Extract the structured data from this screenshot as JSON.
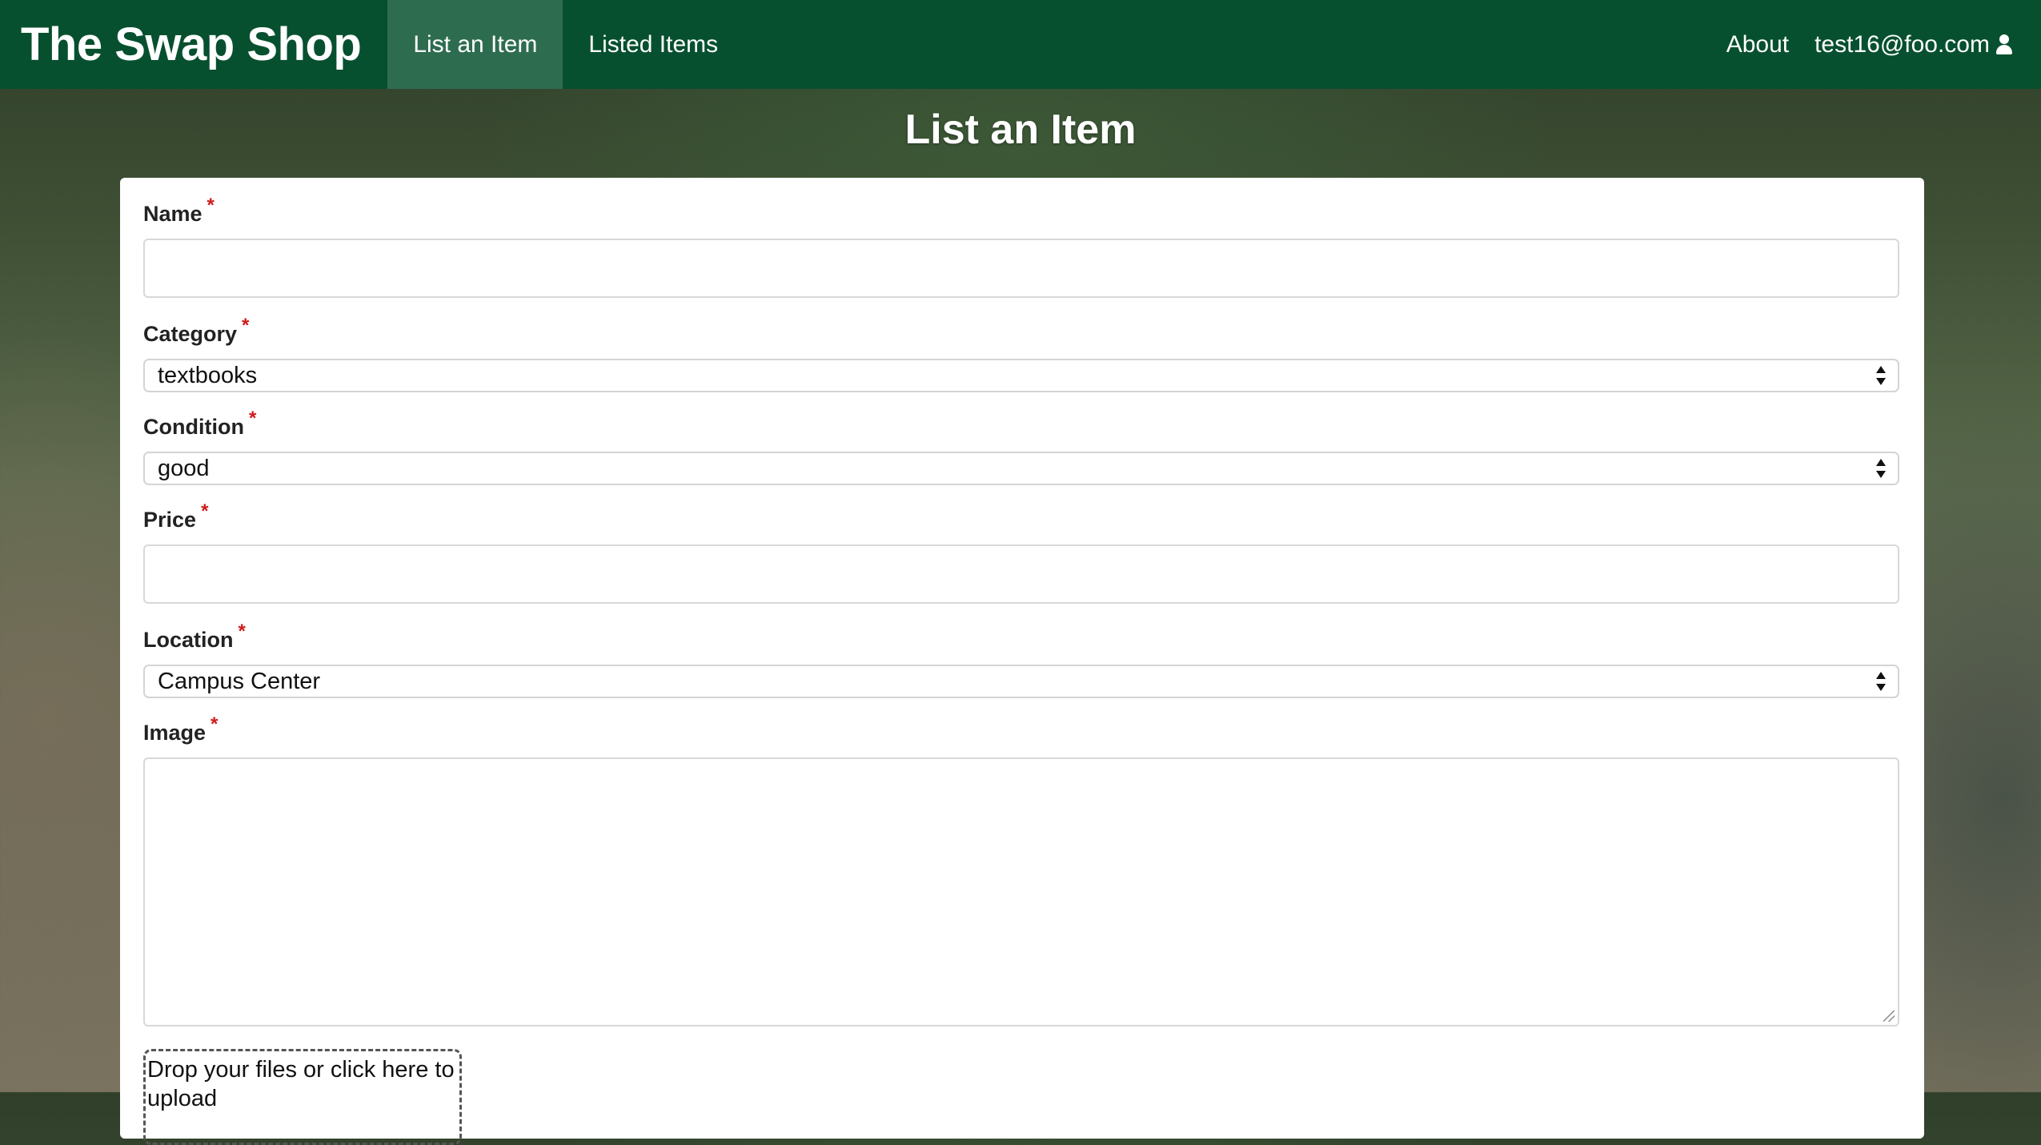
{
  "nav": {
    "brand": "The Swap Shop",
    "links": [
      {
        "label": "List an Item",
        "active": true
      },
      {
        "label": "Listed Items",
        "active": false
      }
    ],
    "about": "About",
    "user_email": "test16@foo.com",
    "user_icon": "user-icon"
  },
  "page": {
    "title": "List an Item"
  },
  "form": {
    "name": {
      "label": "Name",
      "required": "*",
      "value": ""
    },
    "category": {
      "label": "Category",
      "required": "*",
      "value": "textbooks"
    },
    "condition": {
      "label": "Condition",
      "required": "*",
      "value": "good"
    },
    "price": {
      "label": "Price",
      "required": "*",
      "value": ""
    },
    "location": {
      "label": "Location",
      "required": "*",
      "value": "Campus Center"
    },
    "image": {
      "label": "Image",
      "required": "*",
      "value": ""
    },
    "dropzone_text": "Drop your files or click here to upload"
  },
  "colors": {
    "navbar": "#07502f",
    "required_mark": "#d01919"
  }
}
